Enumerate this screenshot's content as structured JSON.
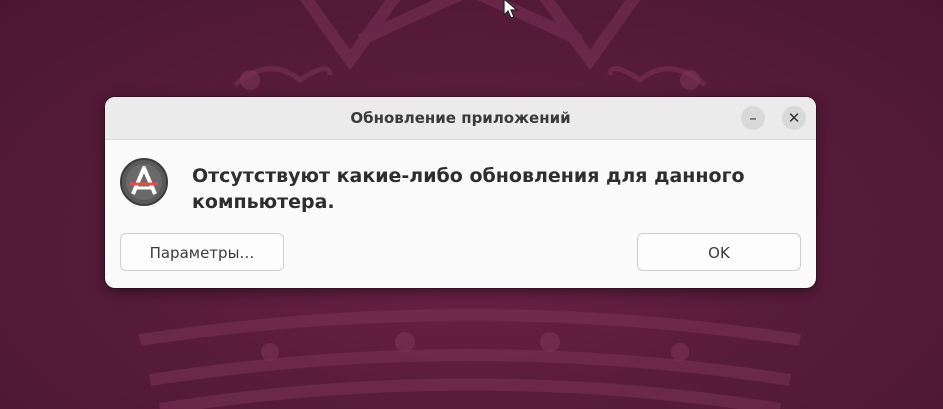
{
  "dialog": {
    "title": "Обновление приложений",
    "message": "Отсутствуют какие-либо обновления для данного компьютера.",
    "settings_button": "Параметры…",
    "ok_button": "OK",
    "minimize_glyph": "–",
    "close_glyph": "✕",
    "app_icon": "software-updater-icon"
  },
  "colors": {
    "wallpaper": "#5a1c3c",
    "dialog_bg": "#fafafa",
    "titlebar_bg": "#ebebeb"
  }
}
